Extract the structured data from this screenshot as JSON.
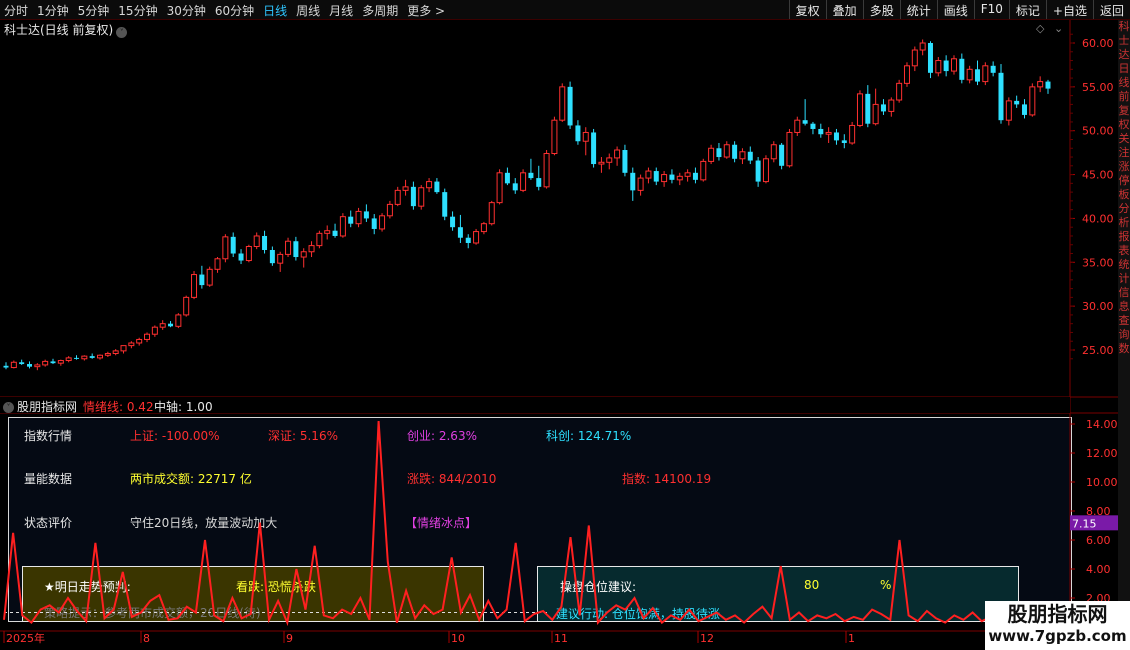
{
  "periods": [
    "分时",
    "1分钟",
    "5分钟",
    "15分钟",
    "30分钟",
    "60分钟",
    "日线",
    "周线",
    "月线",
    "多周期",
    "更多 >"
  ],
  "active_period": "日线",
  "right_buttons": [
    "复权",
    "叠加",
    "多股",
    "统计",
    "画线",
    "F10",
    "标记",
    "+自选",
    "返回"
  ],
  "chart_title": "科士达(日线 前复权)",
  "title_toggle_glyph": "˅",
  "price_axis": [
    "60.00",
    "55.00",
    "50.00",
    "45.00",
    "40.00",
    "35.00",
    "30.00",
    "25.00"
  ],
  "right_stripe_chars": [
    "科",
    "士",
    "达",
    "日",
    "线",
    "前",
    "复",
    "权",
    "关",
    "注",
    "涨",
    "停",
    "板",
    "分",
    "析",
    "报",
    "表",
    "统",
    "计",
    "信",
    "息",
    "查",
    "询",
    "数"
  ],
  "indicator_bar": {
    "name": "股朋指标网",
    "line_label": "情绪线: 0.42",
    "axis_label": "中轴: 1.00"
  },
  "indicator_axis": [
    "14.00",
    "12.00",
    "10.00",
    "8.00",
    "6.00",
    "4.00",
    "2.00"
  ],
  "indicator_current": "7.15",
  "panel": {
    "row1_label": "指数行情",
    "sh": "上证: -100.00%",
    "sz": "深证: 5.16%",
    "cy": "创业: 2.63%",
    "kc": "科创: 124.71%",
    "row2_label": "量能数据",
    "volume": "两市成交额: 22717 亿",
    "updown": "涨跌: 844/2010",
    "index": "指数: 14100.19",
    "row3_label": "状态评价",
    "status": "守住20日线，放量波动加大",
    "emotion": "【情绪冰点】",
    "forecast_label": "★明日走势预判:",
    "forecast": "看跌: 恐慌杀跌",
    "tip": "策略提示：参考两市成交额，20日线(待)",
    "position_label": "操盘仓位建议:",
    "position_value": "80",
    "position_unit": "%",
    "action": "建议行动: 仓位饱满，持股待涨"
  },
  "date_axis": [
    "2025年",
    "8",
    "9",
    "10",
    "11",
    "12",
    "1"
  ],
  "watermark": {
    "line1": "股朋指标网",
    "line2": "www.7gpzb.com"
  },
  "colors": {
    "up": "#ff3030",
    "down": "#2ee0ff",
    "active": "#2ec5ff",
    "indicator": "#ff2020"
  },
  "candles": [
    [
      23.2,
      23.6,
      22.8,
      23.0
    ],
    [
      23.0,
      23.8,
      22.9,
      23.6
    ],
    [
      23.6,
      23.9,
      23.3,
      23.4
    ],
    [
      23.4,
      23.7,
      22.9,
      23.1
    ],
    [
      23.1,
      23.5,
      22.7,
      23.3
    ],
    [
      23.3,
      23.9,
      23.1,
      23.7
    ],
    [
      23.7,
      24.0,
      23.4,
      23.5
    ],
    [
      23.5,
      23.9,
      23.2,
      23.8
    ],
    [
      23.8,
      24.3,
      23.6,
      24.1
    ],
    [
      24.1,
      24.4,
      23.9,
      24.0
    ],
    [
      24.0,
      24.4,
      23.8,
      24.3
    ],
    [
      24.3,
      24.6,
      24.0,
      24.1
    ],
    [
      24.1,
      24.5,
      23.9,
      24.4
    ],
    [
      24.4,
      24.8,
      24.2,
      24.6
    ],
    [
      24.6,
      25.1,
      24.4,
      24.9
    ],
    [
      24.9,
      25.3,
      24.6,
      25.5
    ],
    [
      25.5,
      26.0,
      25.2,
      25.8
    ],
    [
      25.8,
      26.4,
      25.5,
      26.2
    ],
    [
      26.2,
      27.0,
      25.9,
      26.8
    ],
    [
      26.8,
      27.8,
      26.5,
      27.6
    ],
    [
      27.6,
      28.4,
      27.3,
      28.0
    ],
    [
      28.0,
      28.3,
      27.6,
      27.7
    ],
    [
      27.7,
      29.2,
      27.5,
      29.0
    ],
    [
      29.0,
      31.2,
      28.8,
      31.0
    ],
    [
      31.0,
      34.0,
      30.8,
      33.6
    ],
    [
      33.6,
      34.6,
      32.0,
      32.4
    ],
    [
      32.4,
      34.5,
      32.2,
      34.2
    ],
    [
      34.2,
      35.6,
      33.8,
      35.4
    ],
    [
      35.4,
      38.2,
      35.0,
      37.9
    ],
    [
      37.9,
      38.4,
      35.6,
      36.0
    ],
    [
      36.0,
      36.5,
      34.8,
      35.2
    ],
    [
      35.2,
      37.0,
      35.0,
      36.8
    ],
    [
      36.8,
      38.4,
      36.5,
      38.0
    ],
    [
      38.0,
      38.6,
      36.0,
      36.4
    ],
    [
      36.4,
      36.8,
      34.6,
      34.9
    ],
    [
      34.9,
      36.2,
      33.9,
      35.9
    ],
    [
      35.9,
      37.8,
      35.6,
      37.4
    ],
    [
      37.4,
      37.9,
      35.2,
      35.6
    ],
    [
      35.6,
      36.6,
      34.4,
      36.2
    ],
    [
      36.2,
      37.4,
      35.6,
      36.9
    ],
    [
      36.9,
      38.6,
      36.6,
      38.3
    ],
    [
      38.3,
      39.2,
      37.6,
      38.6
    ],
    [
      38.6,
      39.4,
      37.8,
      38.0
    ],
    [
      38.0,
      40.6,
      37.8,
      40.2
    ],
    [
      40.2,
      40.9,
      39.0,
      39.4
    ],
    [
      39.4,
      41.2,
      39.0,
      40.8
    ],
    [
      40.8,
      41.6,
      39.6,
      40.0
    ],
    [
      40.0,
      40.5,
      38.2,
      38.8
    ],
    [
      38.8,
      40.6,
      38.5,
      40.3
    ],
    [
      40.3,
      42.0,
      40.0,
      41.6
    ],
    [
      41.6,
      43.6,
      41.4,
      43.2
    ],
    [
      43.2,
      44.4,
      42.6,
      43.6
    ],
    [
      43.6,
      44.2,
      41.0,
      41.4
    ],
    [
      41.4,
      43.8,
      41.0,
      43.5
    ],
    [
      43.5,
      44.6,
      43.0,
      44.2
    ],
    [
      44.2,
      44.6,
      42.8,
      43.0
    ],
    [
      43.0,
      43.4,
      39.8,
      40.2
    ],
    [
      40.2,
      40.8,
      38.6,
      39.0
    ],
    [
      39.0,
      40.4,
      37.2,
      37.8
    ],
    [
      37.8,
      38.2,
      36.6,
      37.2
    ],
    [
      37.2,
      38.8,
      37.0,
      38.5
    ],
    [
      38.5,
      39.6,
      38.2,
      39.4
    ],
    [
      39.4,
      42.0,
      39.2,
      41.8
    ],
    [
      41.8,
      45.6,
      41.6,
      45.2
    ],
    [
      45.2,
      45.8,
      43.8,
      44.0
    ],
    [
      44.0,
      44.6,
      42.8,
      43.2
    ],
    [
      43.2,
      45.6,
      43.0,
      45.2
    ],
    [
      45.2,
      46.8,
      44.4,
      44.6
    ],
    [
      44.6,
      46.0,
      43.2,
      43.6
    ],
    [
      43.6,
      47.8,
      43.4,
      47.4
    ],
    [
      47.4,
      51.6,
      47.2,
      51.2
    ],
    [
      51.2,
      55.4,
      51.0,
      55.0
    ],
    [
      55.0,
      55.6,
      50.2,
      50.6
    ],
    [
      50.6,
      51.2,
      48.4,
      48.8
    ],
    [
      48.8,
      50.4,
      47.2,
      49.8
    ],
    [
      49.8,
      50.2,
      45.8,
      46.2
    ],
    [
      46.2,
      47.0,
      45.2,
      46.4
    ],
    [
      46.4,
      47.4,
      45.6,
      46.9
    ],
    [
      46.9,
      48.2,
      46.0,
      47.8
    ],
    [
      47.8,
      48.4,
      44.8,
      45.2
    ],
    [
      45.2,
      45.8,
      42.0,
      43.2
    ],
    [
      43.2,
      45.0,
      42.6,
      44.6
    ],
    [
      44.6,
      45.8,
      44.0,
      45.4
    ],
    [
      45.4,
      45.8,
      43.8,
      44.2
    ],
    [
      44.2,
      45.4,
      43.6,
      45.0
    ],
    [
      45.0,
      45.6,
      44.0,
      44.4
    ],
    [
      44.4,
      45.2,
      43.8,
      44.8
    ],
    [
      44.8,
      45.6,
      44.2,
      45.2
    ],
    [
      45.2,
      45.8,
      44.0,
      44.4
    ],
    [
      44.4,
      46.8,
      44.2,
      46.5
    ],
    [
      46.5,
      48.4,
      46.2,
      48.0
    ],
    [
      48.0,
      48.6,
      46.6,
      47.0
    ],
    [
      47.0,
      48.8,
      46.8,
      48.4
    ],
    [
      48.4,
      48.8,
      46.4,
      46.8
    ],
    [
      46.8,
      48.0,
      46.2,
      47.6
    ],
    [
      47.6,
      48.2,
      46.2,
      46.6
    ],
    [
      46.6,
      47.0,
      43.6,
      44.2
    ],
    [
      44.2,
      47.2,
      44.0,
      46.8
    ],
    [
      46.8,
      48.8,
      46.4,
      48.4
    ],
    [
      48.4,
      48.6,
      45.6,
      46.0
    ],
    [
      46.0,
      50.2,
      45.8,
      49.8
    ],
    [
      49.8,
      51.6,
      49.4,
      51.2
    ],
    [
      51.2,
      53.6,
      50.6,
      50.8
    ],
    [
      50.8,
      51.0,
      49.6,
      50.2
    ],
    [
      50.2,
      50.8,
      49.2,
      49.6
    ],
    [
      49.6,
      50.4,
      48.6,
      49.8
    ],
    [
      49.8,
      50.2,
      48.4,
      48.9
    ],
    [
      48.9,
      49.6,
      48.0,
      48.6
    ],
    [
      48.6,
      51.0,
      48.4,
      50.6
    ],
    [
      50.6,
      54.6,
      50.4,
      54.2
    ],
    [
      54.2,
      55.2,
      50.4,
      50.8
    ],
    [
      50.8,
      54.8,
      50.6,
      53.0
    ],
    [
      53.0,
      53.6,
      51.8,
      52.2
    ],
    [
      52.2,
      53.8,
      51.6,
      53.5
    ],
    [
      53.5,
      55.8,
      53.2,
      55.4
    ],
    [
      55.4,
      57.8,
      55.0,
      57.4
    ],
    [
      57.4,
      59.6,
      56.8,
      59.2
    ],
    [
      59.2,
      60.4,
      58.6,
      60.0
    ],
    [
      60.0,
      60.2,
      56.0,
      56.6
    ],
    [
      56.6,
      58.4,
      56.2,
      58.0
    ],
    [
      58.0,
      58.6,
      56.2,
      56.8
    ],
    [
      56.8,
      58.6,
      56.4,
      58.2
    ],
    [
      58.2,
      58.8,
      55.4,
      55.8
    ],
    [
      55.8,
      57.4,
      55.4,
      57.0
    ],
    [
      57.0,
      58.0,
      55.2,
      55.6
    ],
    [
      55.6,
      57.8,
      55.2,
      57.4
    ],
    [
      57.4,
      57.9,
      56.2,
      56.6
    ],
    [
      56.6,
      57.6,
      50.8,
      51.2
    ],
    [
      51.2,
      53.8,
      50.6,
      53.4
    ],
    [
      53.4,
      54.0,
      52.6,
      53.0
    ],
    [
      53.0,
      53.6,
      51.4,
      51.8
    ],
    [
      51.8,
      55.4,
      51.6,
      55.0
    ],
    [
      55.0,
      56.2,
      54.4,
      55.6
    ],
    [
      55.6,
      55.8,
      54.2,
      54.8
    ]
  ],
  "indicator_series": [
    0.5,
    6.5,
    0.8,
    0.3,
    1.2,
    1.5,
    1.0,
    2.0,
    1.1,
    0.4,
    5.8,
    0.6,
    1.2,
    3.8,
    0.7,
    1.0,
    1.8,
    2.2,
    0.5,
    0.6,
    1.4,
    1.0,
    6.0,
    0.8,
    0.4,
    2.0,
    0.6,
    0.9,
    7.2,
    0.5,
    1.8,
    0.3,
    4.0,
    1.2,
    5.6,
    0.8,
    0.6,
    1.2,
    0.9,
    2.0,
    0.5,
    14.2,
    4.5,
    0.3,
    2.5,
    0.6,
    1.5,
    0.9,
    1.2,
    4.8,
    1.0,
    2.2,
    0.5,
    1.8,
    0.6,
    1.2,
    5.8,
    0.4,
    0.9,
    1.1,
    0.5,
    1.4,
    6.2,
    0.8,
    7.0,
    0.3,
    1.0,
    1.5,
    1.2,
    2.0,
    0.6,
    1.3,
    0.3,
    0.8,
    0.5,
    1.2,
    0.4,
    0.7,
    1.0,
    0.5,
    0.8,
    0.3,
    0.9,
    1.4,
    0.6,
    4.2,
    0.5,
    1.0,
    0.4,
    0.8,
    0.6,
    0.9,
    0.4,
    0.7,
    0.5,
    1.2,
    0.9,
    0.5,
    6.0,
    0.8,
    0.4,
    1.1,
    0.6,
    0.3,
    0.8,
    0.5,
    1.0,
    0.4,
    0.7,
    0.5
  ]
}
